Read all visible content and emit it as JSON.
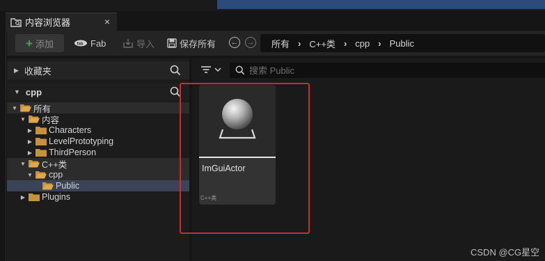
{
  "tab": {
    "title": "内容浏览器",
    "close": "×"
  },
  "toolbar": {
    "add_label": "添加",
    "fab_label": "Fab",
    "import_label": "导入",
    "save_all_label": "保存所有"
  },
  "breadcrumb": [
    "所有",
    "C++类",
    "cpp",
    "Public"
  ],
  "left": {
    "favorites_label": "收藏夹",
    "project_label": "cpp"
  },
  "tree": [
    {
      "label": "所有",
      "depth": 0,
      "expanded": true
    },
    {
      "label": "内容",
      "depth": 1,
      "expanded": true
    },
    {
      "label": "Characters",
      "depth": 2,
      "expanded": false
    },
    {
      "label": "LevelPrototyping",
      "depth": 2,
      "expanded": false
    },
    {
      "label": "ThirdPerson",
      "depth": 2,
      "expanded": false
    },
    {
      "label": "C++类",
      "depth": 1,
      "expanded": true
    },
    {
      "label": "cpp",
      "depth": 2,
      "expanded": true
    },
    {
      "label": "Public",
      "depth": 3,
      "selected": true
    },
    {
      "label": "Plugins",
      "depth": 1,
      "expanded": false
    }
  ],
  "content": {
    "search_placeholder": "搜索 Public",
    "asset": {
      "name": "ImGuiActor",
      "type": "C++类"
    }
  },
  "watermark": "CSDN @CG星空",
  "colors": {
    "highlight_box": "#d9262c",
    "folder": "#c8923a",
    "selected_row": "#3a4456"
  }
}
